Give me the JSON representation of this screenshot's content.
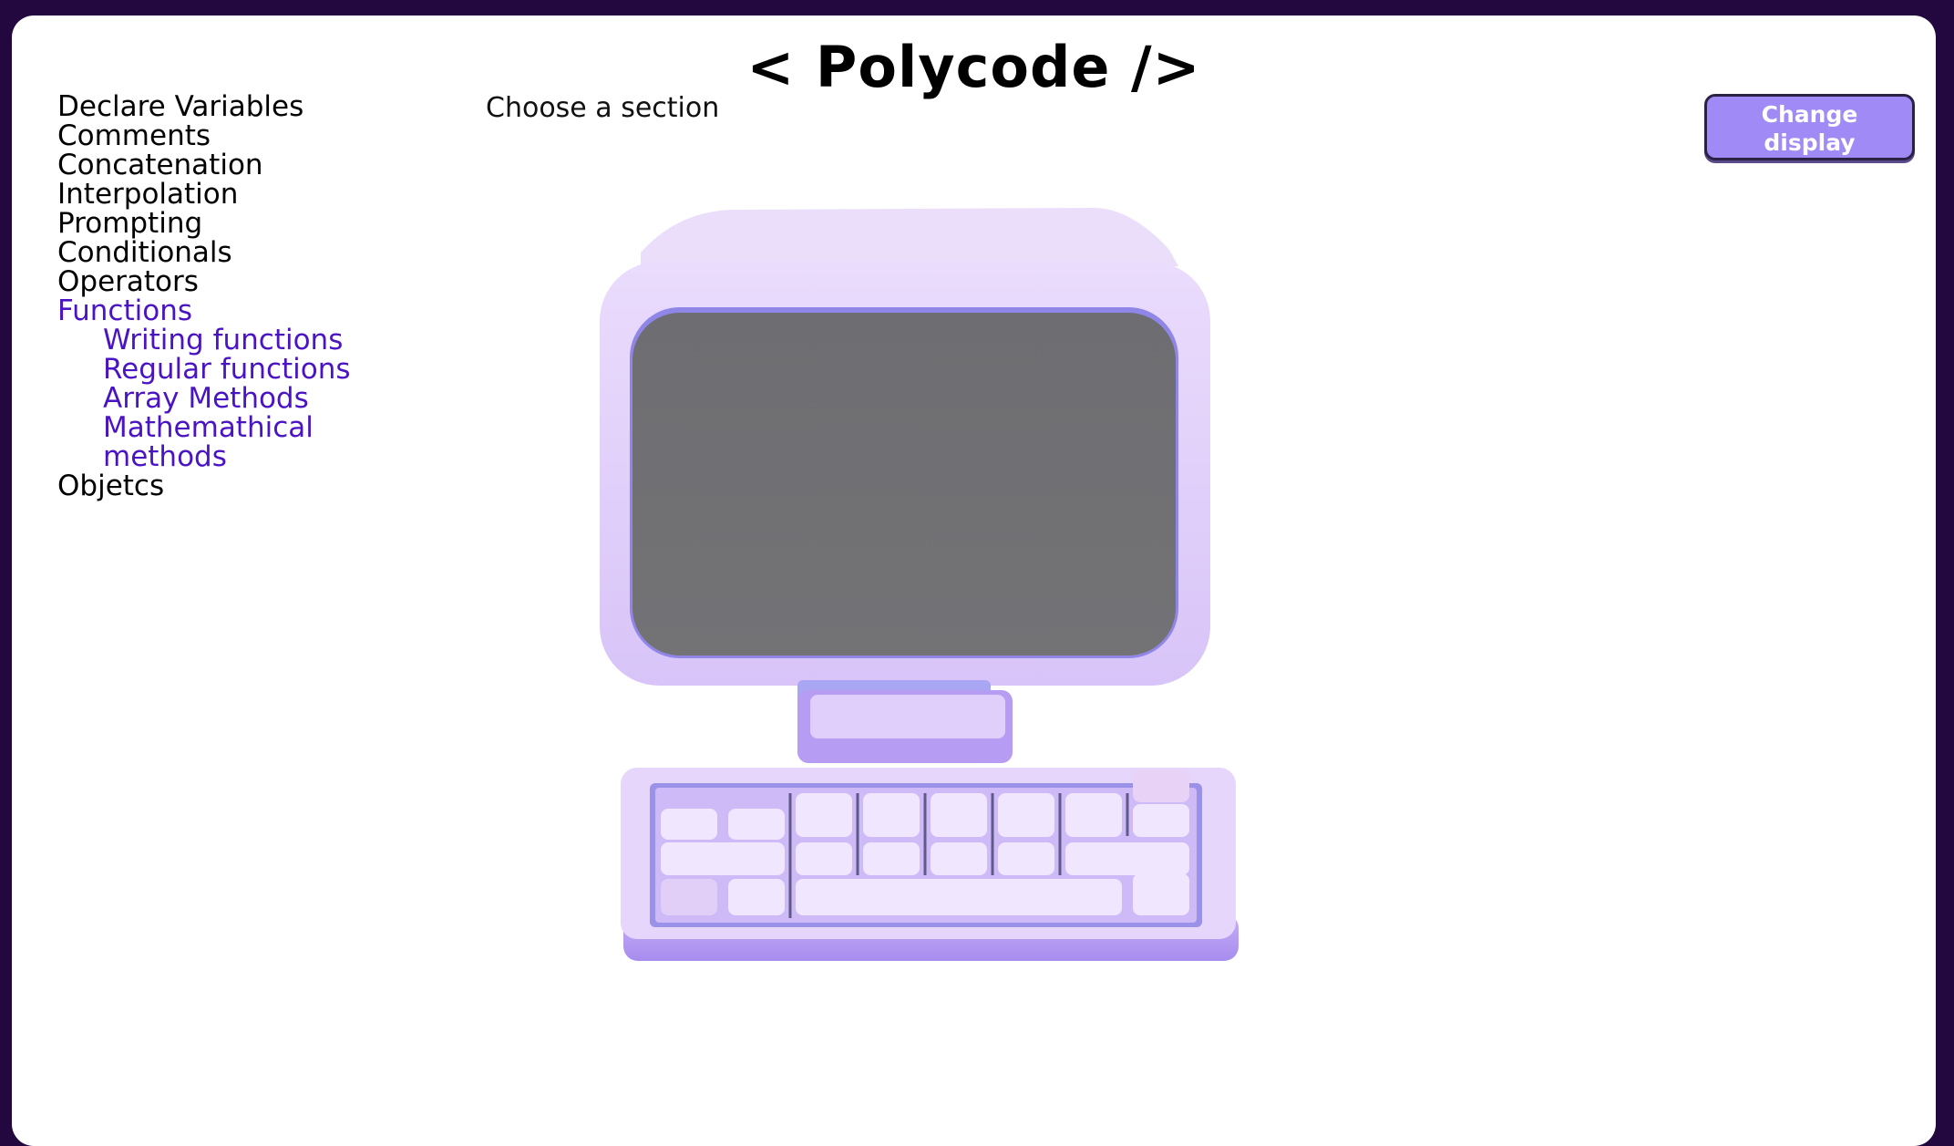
{
  "header": {
    "title": "< Polycode />"
  },
  "sidebar": {
    "items": [
      {
        "label": "Declare Variables"
      },
      {
        "label": "Comments"
      },
      {
        "label": "Concatenation"
      },
      {
        "label": "Interpolation"
      },
      {
        "label": "Prompting"
      },
      {
        "label": "Conditionals"
      },
      {
        "label": "Operators"
      },
      {
        "label": "Functions"
      },
      {
        "label": "Objetcs"
      }
    ],
    "functions_subitems": [
      {
        "label": "Writing functions"
      },
      {
        "label": "Regular functions"
      },
      {
        "label": "Array Methods"
      },
      {
        "label": "Mathemathical methods"
      }
    ]
  },
  "main": {
    "prompt": "Choose a section",
    "illustration": "computer-illustration"
  },
  "toolbar": {
    "change_display_label": "Change display"
  },
  "colors": {
    "page_background": "#23083f",
    "card_background": "#ffffff",
    "active_link": "#4a14c4",
    "button_fill": "#a08af5",
    "illustration_lavender": "#e3d2fb",
    "screen_gray": "#6f6f74"
  }
}
